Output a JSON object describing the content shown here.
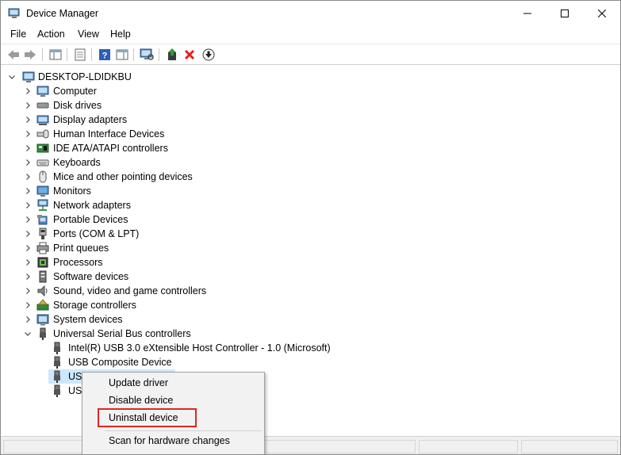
{
  "window": {
    "title": "Device Manager",
    "min_label": "—",
    "max_label": "☐",
    "close_label": "✕"
  },
  "menu": {
    "items": [
      "File",
      "Action",
      "View",
      "Help"
    ]
  },
  "toolbar": {
    "buttons": [
      "back-icon",
      "forward-icon",
      "show-hide-console-tree-icon",
      "properties-icon",
      "help-icon",
      "action-pane-icon",
      "scan-hardware-icon",
      "update-driver-icon",
      "uninstall-icon",
      "disable-device-icon"
    ]
  },
  "tree": {
    "root": "DESKTOP-LDIDKBU",
    "categories": [
      {
        "label": "Computer",
        "icon": "computer-icon"
      },
      {
        "label": "Disk drives",
        "icon": "disk-drive-icon"
      },
      {
        "label": "Display adapters",
        "icon": "display-adapter-icon"
      },
      {
        "label": "Human Interface Devices",
        "icon": "hid-icon"
      },
      {
        "label": "IDE ATA/ATAPI controllers",
        "icon": "ide-controller-icon"
      },
      {
        "label": "Keyboards",
        "icon": "keyboard-icon"
      },
      {
        "label": "Mice and other pointing devices",
        "icon": "mouse-icon"
      },
      {
        "label": "Monitors",
        "icon": "monitor-icon"
      },
      {
        "label": "Network adapters",
        "icon": "network-adapter-icon"
      },
      {
        "label": "Portable Devices",
        "icon": "portable-device-icon"
      },
      {
        "label": "Ports (COM & LPT)",
        "icon": "port-icon"
      },
      {
        "label": "Print queues",
        "icon": "printer-icon"
      },
      {
        "label": "Processors",
        "icon": "processor-icon"
      },
      {
        "label": "Software devices",
        "icon": "software-device-icon"
      },
      {
        "label": "Sound, video and game controllers",
        "icon": "sound-icon"
      },
      {
        "label": "Storage controllers",
        "icon": "storage-controller-icon"
      },
      {
        "label": "System devices",
        "icon": "system-device-icon"
      },
      {
        "label": "Universal Serial Bus controllers",
        "icon": "usb-icon"
      }
    ],
    "usb_children": [
      "Intel(R) USB 3.0 eXtensible Host Controller - 1.0 (Microsoft)",
      "USB Composite Device",
      "US",
      "US"
    ]
  },
  "context_menu": {
    "items": [
      "Update driver",
      "Disable device",
      "Uninstall device",
      "Scan for hardware changes"
    ],
    "highlighted": "Uninstall device"
  },
  "colors": {
    "selection": "#cce8ff",
    "highlight_border": "#e12626"
  }
}
